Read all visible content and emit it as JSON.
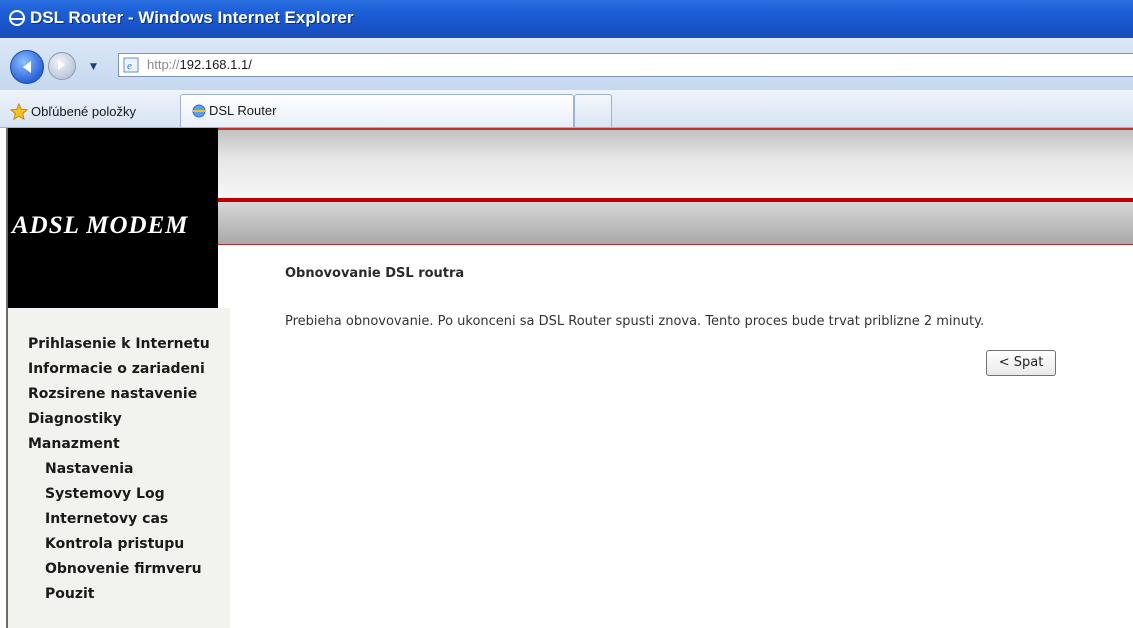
{
  "window": {
    "title": "DSL Router - Windows Internet Explorer"
  },
  "address_bar": {
    "protocol": "http://",
    "host": "192.168.1.1/"
  },
  "favorites_bar": {
    "favorites_label": "Obľúbené položky",
    "tab_label": "DSL Router"
  },
  "header": {
    "logo": "ADSL MODEM"
  },
  "sidebar": {
    "items": [
      "Prihlasenie k Internetu",
      "Informacie o zariadeni",
      "Rozsirene nastavenie",
      "Diagnostiky",
      "Manazment"
    ],
    "subitems": [
      "Nastavenia",
      "Systemovy Log",
      "Internetovy cas",
      "Kontrola pristupu",
      "Obnovenie firmveru",
      "Pouzit"
    ]
  },
  "content": {
    "title": "Obnovovanie DSL routra",
    "message": "Prebieha obnovovanie. Po ukonceni sa DSL Router spusti znova. Tento proces bude trvat priblizne 2 minuty.",
    "back_button": "< Spat"
  },
  "colors": {
    "titlebar": "#1d5fd8",
    "banner_red": "#c00000",
    "logo_bg": "#000000"
  }
}
